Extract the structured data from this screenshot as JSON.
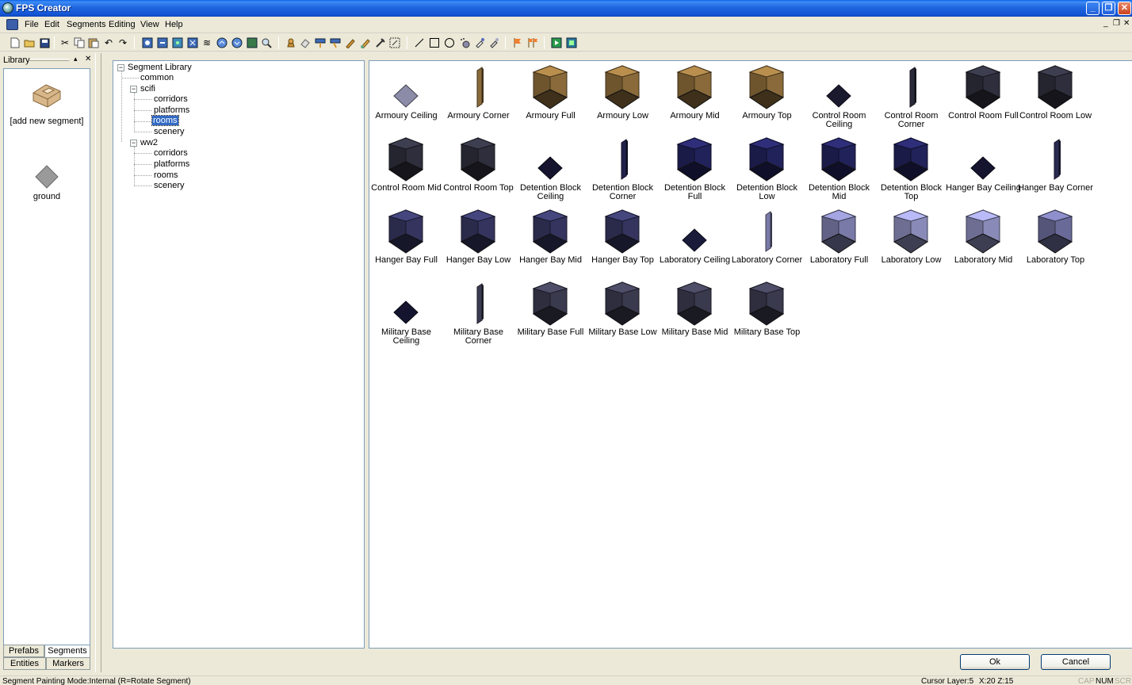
{
  "window": {
    "title": "FPS Creator"
  },
  "menu": [
    "File",
    "Edit",
    "Segments",
    "Editing",
    "View",
    "Help"
  ],
  "library": {
    "title": "Library",
    "items": [
      "[add new segment]",
      "ground"
    ],
    "tabs": [
      "Prefabs",
      "Segments",
      "Entities",
      "Markers"
    ]
  },
  "tree": {
    "root": "Segment Library",
    "nodes": [
      "common",
      "scifi",
      "corridors",
      "platforms",
      "rooms",
      "scenery",
      "ww2",
      "corridors",
      "platforms",
      "rooms",
      "scenery"
    ],
    "selected": "rooms"
  },
  "segments": [
    {
      "label": "Armoury Ceiling",
      "kind": "ceiling",
      "color": "#8c8ca8"
    },
    {
      "label": "Armoury Corner",
      "kind": "corner",
      "color": "#8a6a3a"
    },
    {
      "label": "Armoury Full",
      "kind": "full",
      "color": "#8a6a3a"
    },
    {
      "label": "Armoury Low",
      "kind": "full",
      "color": "#8a6a3a"
    },
    {
      "label": "Armoury Mid",
      "kind": "full",
      "color": "#8a6a3a"
    },
    {
      "label": "Armoury Top",
      "kind": "full",
      "color": "#8a6a3a"
    },
    {
      "label": "Control Room Ceiling",
      "kind": "ceiling",
      "color": "#1a1a2e"
    },
    {
      "label": "Control Room Corner",
      "kind": "corner",
      "color": "#2a2a3a"
    },
    {
      "label": "Control Room Full",
      "kind": "full",
      "color": "#2e2e3c"
    },
    {
      "label": "Control Room Low",
      "kind": "full",
      "color": "#2e2e3c"
    },
    {
      "label": "Control Room Mid",
      "kind": "full",
      "color": "#2e2e3c"
    },
    {
      "label": "Control Room Top",
      "kind": "full",
      "color": "#2e2e3c"
    },
    {
      "label": "Detention Block Ceiling",
      "kind": "ceiling",
      "color": "#14142e"
    },
    {
      "label": "Detention Block Corner",
      "kind": "corner",
      "color": "#22224a"
    },
    {
      "label": "Detention Block Full",
      "kind": "full",
      "color": "#22225a"
    },
    {
      "label": "Detention Block Low",
      "kind": "full",
      "color": "#22225a"
    },
    {
      "label": "Detention Block Mid",
      "kind": "full",
      "color": "#22225a"
    },
    {
      "label": "Detention Block Top",
      "kind": "full",
      "color": "#22225a"
    },
    {
      "label": "Hanger Bay Ceiling",
      "kind": "ceiling",
      "color": "#14142e"
    },
    {
      "label": "Hanger Bay Corner",
      "kind": "corner",
      "color": "#2a2a50"
    },
    {
      "label": "Hanger Bay Full",
      "kind": "full",
      "color": "#34345e"
    },
    {
      "label": "Hanger Bay Low",
      "kind": "full",
      "color": "#34345e"
    },
    {
      "label": "Hanger Bay Mid",
      "kind": "full",
      "color": "#34345e"
    },
    {
      "label": "Hanger Bay Top",
      "kind": "full",
      "color": "#34345e"
    },
    {
      "label": "Laboratory Ceiling",
      "kind": "ceiling",
      "color": "#1a1a3a"
    },
    {
      "label": "Laboratory Corner",
      "kind": "corner",
      "color": "#7a7aa8"
    },
    {
      "label": "Laboratory Full",
      "kind": "full",
      "color": "#7a7aa8"
    },
    {
      "label": "Laboratory Low",
      "kind": "full",
      "color": "#8a8ab8"
    },
    {
      "label": "Laboratory Mid",
      "kind": "full",
      "color": "#8a8ab8"
    },
    {
      "label": "Laboratory Top",
      "kind": "full",
      "color": "#6a6a98"
    },
    {
      "label": "Military Base Ceiling",
      "kind": "ceiling",
      "color": "#14142e"
    },
    {
      "label": "Military Base Corner",
      "kind": "corner",
      "color": "#3a3a50"
    },
    {
      "label": "Military Base Full",
      "kind": "full",
      "color": "#3a3a4e"
    },
    {
      "label": "Military Base Low",
      "kind": "full",
      "color": "#3a3a4e"
    },
    {
      "label": "Military Base Mid",
      "kind": "full",
      "color": "#3a3a4e"
    },
    {
      "label": "Military Base Top",
      "kind": "full",
      "color": "#3a3a4e"
    }
  ],
  "buttons": {
    "ok": "Ok",
    "cancel": "Cancel"
  },
  "status": {
    "mode": "Segment Painting Mode:Internal (R=Rotate Segment)",
    "cursor": "Cursor Layer:5",
    "coords": "X:20  Z:15",
    "cap": "CAP",
    "num": "NUM",
    "scrl": "SCRL"
  }
}
